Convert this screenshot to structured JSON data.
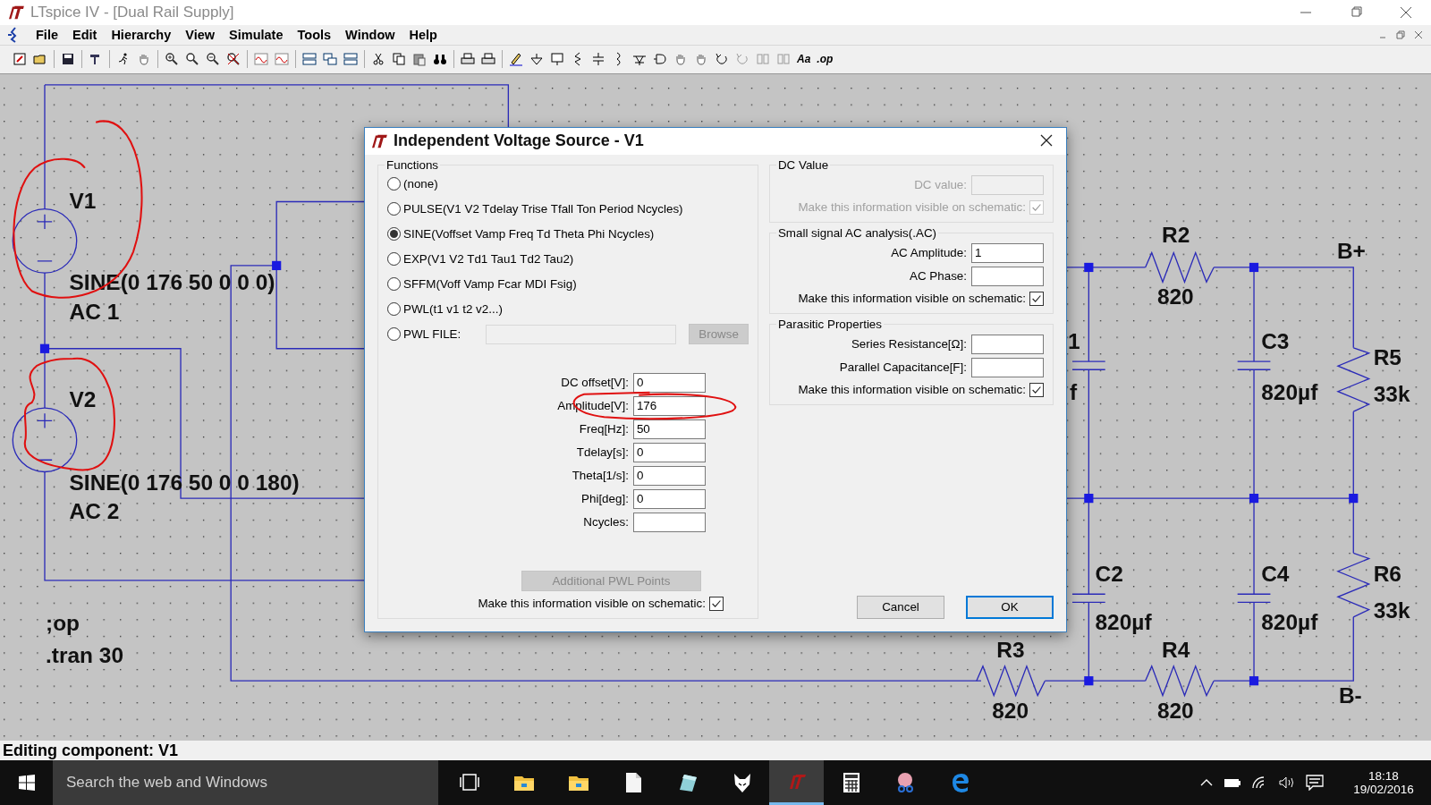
{
  "window": {
    "title": "LTspice IV - [Dual Rail Supply]"
  },
  "menu": [
    {
      "label": "File"
    },
    {
      "label": "Edit"
    },
    {
      "label": "Hierarchy"
    },
    {
      "label": "View"
    },
    {
      "label": "Simulate"
    },
    {
      "label": "Tools"
    },
    {
      "label": "Window"
    },
    {
      "label": "Help"
    }
  ],
  "toolbar": {
    "text_buttons": [
      "Aa",
      ".op"
    ]
  },
  "schematic": {
    "labels": [
      {
        "text": "V1"
      },
      {
        "text": "SINE(0 176 50 0 0 0)"
      },
      {
        "text": "AC 1"
      },
      {
        "text": "V2"
      },
      {
        "text": "SINE(0 176 50 0 0 180)"
      },
      {
        "text": "AC 2"
      },
      {
        "text": ";op"
      },
      {
        "text": ".tran 30"
      },
      {
        "text": "R2"
      },
      {
        "text": "820"
      },
      {
        "text": "B+"
      },
      {
        "text": "1"
      },
      {
        "text": "f"
      },
      {
        "text": "C3"
      },
      {
        "text": "820µf"
      },
      {
        "text": "R5"
      },
      {
        "text": "33k"
      },
      {
        "text": "C2"
      },
      {
        "text": "820µf"
      },
      {
        "text": "C4"
      },
      {
        "text": "820µf"
      },
      {
        "text": "R6"
      },
      {
        "text": "33k"
      },
      {
        "text": "R3"
      },
      {
        "text": "820"
      },
      {
        "text": "R4"
      },
      {
        "text": "820"
      },
      {
        "text": "B-"
      }
    ]
  },
  "dialog": {
    "title": "Independent Voltage Source - V1",
    "functions": {
      "title": "Functions",
      "options": [
        {
          "label": "(none)",
          "selected": false
        },
        {
          "label": "PULSE(V1 V2 Tdelay Trise Tfall Ton Period Ncycles)",
          "selected": false
        },
        {
          "label": "SINE(Voffset Vamp Freq Td Theta Phi Ncycles)",
          "selected": true
        },
        {
          "label": "EXP(V1 V2 Td1 Tau1 Td2 Tau2)",
          "selected": false
        },
        {
          "label": "SFFM(Voff Vamp Fcar MDI Fsig)",
          "selected": false
        },
        {
          "label": "PWL(t1 v1 t2 v2...)",
          "selected": false
        },
        {
          "label": "PWL FILE:",
          "selected": false
        }
      ],
      "browse_button": "Browse",
      "params": [
        {
          "label": "DC offset[V]:",
          "value": "0"
        },
        {
          "label": "Amplitude[V]:",
          "value": "176"
        },
        {
          "label": "Freq[Hz]:",
          "value": "50"
        },
        {
          "label": "Tdelay[s]:",
          "value": "0"
        },
        {
          "label": "Theta[1/s]:",
          "value": "0"
        },
        {
          "label": "Phi[deg]:",
          "value": "0"
        },
        {
          "label": "Ncycles:"
        }
      ],
      "pwl_button": "Additional PWL Points",
      "visible": {
        "label": "Make this information visible on schematic:",
        "checked": true
      }
    },
    "groups": [
      {
        "title": "DC Value",
        "disabled": true,
        "fields": [
          {
            "label": "DC value:"
          }
        ],
        "visible": {
          "label": "Make this information visible on schematic:",
          "checked": true
        }
      },
      {
        "title": "Small signal AC analysis(.AC)",
        "disabled": false,
        "fields": [
          {
            "label": "AC Amplitude:",
            "value": "1"
          },
          {
            "label": "AC Phase:"
          }
        ],
        "visible": {
          "label": "Make this information visible on schematic:",
          "checked": true
        }
      },
      {
        "title": "Parasitic Properties",
        "disabled": false,
        "fields": [
          {
            "label": "Series Resistance[Ω]:"
          },
          {
            "label": "Parallel Capacitance[F]:"
          }
        ],
        "visible": {
          "label": "Make this information visible on schematic:",
          "checked": true
        }
      }
    ],
    "buttons": [
      {
        "label": "Cancel",
        "default": false
      },
      {
        "label": "OK",
        "default": true
      }
    ]
  },
  "status_bar": "Editing component: V1",
  "taskbar": {
    "search_placeholder": "Search the web and Windows",
    "apps": [
      {
        "kind": "task-view",
        "active": false
      },
      {
        "kind": "folder",
        "active": false
      },
      {
        "kind": "folder",
        "active": false
      },
      {
        "kind": "document",
        "active": false
      },
      {
        "kind": "ruler",
        "active": false
      },
      {
        "kind": "fox",
        "active": false
      },
      {
        "kind": "ltspice",
        "active": true
      },
      {
        "kind": "calculator",
        "active": false
      },
      {
        "kind": "scissors",
        "active": false
      },
      {
        "kind": "browser",
        "active": false
      }
    ],
    "time": "18:18",
    "date": "19/02/2016"
  }
}
